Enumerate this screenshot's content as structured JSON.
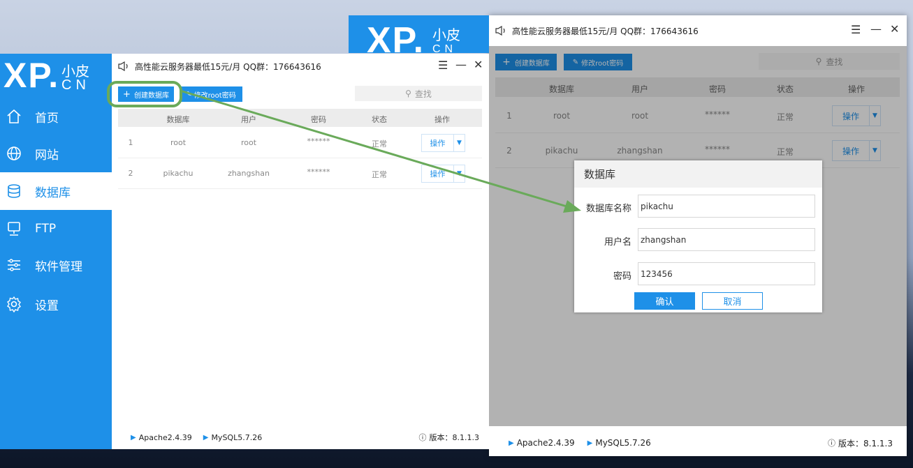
{
  "app": {
    "logo_xp": "XP.",
    "logo_zh": "小皮",
    "logo_cn": "CN",
    "title": "高性能云服务器最低15元/月  QQ群：176643616",
    "accent_color": "#1e90e8"
  },
  "sidebar": {
    "items": [
      {
        "label": "首页",
        "icon": "home-icon"
      },
      {
        "label": "网站",
        "icon": "globe-icon"
      },
      {
        "label": "数据库",
        "icon": "database-icon"
      },
      {
        "label": "FTP",
        "icon": "server-icon"
      },
      {
        "label": "软件管理",
        "icon": "sliders-icon"
      },
      {
        "label": "设置",
        "icon": "gear-icon"
      }
    ],
    "active": "数据库"
  },
  "toolbar": {
    "create_label": "创建数据库",
    "modify_label": "修改root密码",
    "search_placeholder": "查找"
  },
  "table": {
    "headers": [
      "",
      "数据库",
      "用户",
      "密码",
      "状态",
      "操作"
    ],
    "rows": [
      {
        "num": "1",
        "db": "root",
        "user": "root",
        "pwd": "******",
        "status": "正常",
        "op": "操作"
      },
      {
        "num": "2",
        "db": "pikachu",
        "user": "zhangshan",
        "pwd": "******",
        "status": "正常",
        "op": "操作"
      }
    ]
  },
  "footer": {
    "apache": "Apache2.4.39",
    "mysql": "MySQL5.7.26",
    "version": "版本：8.1.1.3"
  },
  "dialog": {
    "title": "数据库",
    "name_label": "数据库名称",
    "name_value": "pikachu",
    "user_label": "用户名",
    "user_value": "zhangshan",
    "pwd_label": "密码",
    "pwd_value": "123456",
    "confirm_label": "确认",
    "cancel_label": "取消"
  },
  "annotation": {
    "arrow_color": "#6aaa5a"
  }
}
